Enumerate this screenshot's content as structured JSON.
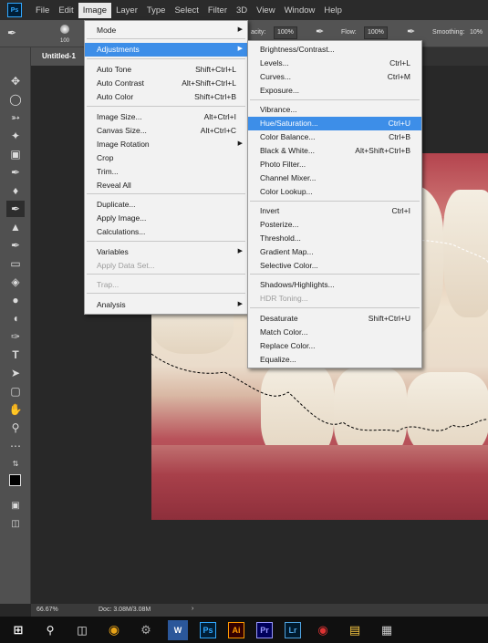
{
  "menubar": {
    "logo": "Ps",
    "items": [
      "File",
      "Edit",
      "Image",
      "Layer",
      "Type",
      "Select",
      "Filter",
      "3D",
      "View",
      "Window",
      "Help"
    ],
    "active": "Image"
  },
  "options": {
    "brush_size": "100",
    "opacity_label": "acity:",
    "opacity_value": "100%",
    "flow_label": "Flow:",
    "flow_value": "100%",
    "smoothing_label": "Smoothing:",
    "smoothing_value": "10%"
  },
  "document": {
    "tab_title": "Untitled-1"
  },
  "status": {
    "zoom": "66.67%",
    "doc_info": "Doc: 3.08M/3.08M"
  },
  "image_menu": {
    "items": [
      {
        "label": "Mode",
        "submenu": true
      },
      {
        "label": "Adjustments",
        "submenu": true,
        "highlight": true
      },
      {
        "label": "Auto Tone",
        "shortcut": "Shift+Ctrl+L"
      },
      {
        "label": "Auto Contrast",
        "shortcut": "Alt+Shift+Ctrl+L"
      },
      {
        "label": "Auto Color",
        "shortcut": "Shift+Ctrl+B"
      },
      {
        "label": "Image Size...",
        "shortcut": "Alt+Ctrl+I"
      },
      {
        "label": "Canvas Size...",
        "shortcut": "Alt+Ctrl+C"
      },
      {
        "label": "Image Rotation",
        "submenu": true
      },
      {
        "label": "Crop"
      },
      {
        "label": "Trim..."
      },
      {
        "label": "Reveal All"
      },
      {
        "label": "Duplicate..."
      },
      {
        "label": "Apply Image..."
      },
      {
        "label": "Calculations..."
      },
      {
        "label": "Variables",
        "submenu": true
      },
      {
        "label": "Apply Data Set...",
        "disabled": true
      },
      {
        "label": "Trap...",
        "disabled": true
      },
      {
        "label": "Analysis",
        "submenu": true
      }
    ]
  },
  "adjustments_menu": {
    "items": [
      {
        "label": "Brightness/Contrast..."
      },
      {
        "label": "Levels...",
        "shortcut": "Ctrl+L"
      },
      {
        "label": "Curves...",
        "shortcut": "Ctrl+M"
      },
      {
        "label": "Exposure..."
      },
      {
        "label": "Vibrance..."
      },
      {
        "label": "Hue/Saturation...",
        "shortcut": "Ctrl+U",
        "highlight": true
      },
      {
        "label": "Color Balance...",
        "shortcut": "Ctrl+B"
      },
      {
        "label": "Black & White...",
        "shortcut": "Alt+Shift+Ctrl+B"
      },
      {
        "label": "Photo Filter..."
      },
      {
        "label": "Channel Mixer..."
      },
      {
        "label": "Color Lookup..."
      },
      {
        "label": "Invert",
        "shortcut": "Ctrl+I"
      },
      {
        "label": "Posterize..."
      },
      {
        "label": "Threshold..."
      },
      {
        "label": "Gradient Map..."
      },
      {
        "label": "Selective Color..."
      },
      {
        "label": "Shadows/Highlights..."
      },
      {
        "label": "HDR Toning...",
        "disabled": true
      },
      {
        "label": "Desaturate",
        "shortcut": "Shift+Ctrl+U"
      },
      {
        "label": "Match Color..."
      },
      {
        "label": "Replace Color..."
      },
      {
        "label": "Equalize..."
      }
    ]
  },
  "taskbar": {
    "apps": [
      "Ps",
      "Ai",
      "Pr",
      "Lr"
    ],
    "colors": {
      "ps": "#31a8ff",
      "ai": "#ff9a00",
      "pr": "#9999ff",
      "lr": "#4fa3e0"
    }
  }
}
